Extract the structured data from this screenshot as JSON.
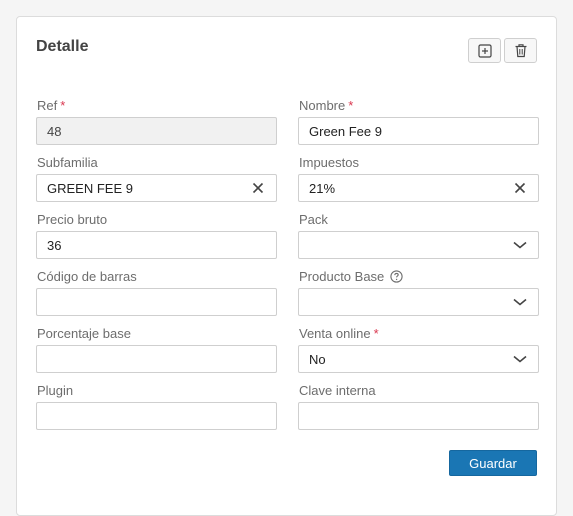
{
  "card": {
    "title": "Detalle"
  },
  "toolbar": {
    "add_icon": "plus-square-icon",
    "delete_icon": "trash-icon"
  },
  "fields": {
    "ref": {
      "label": "Ref",
      "required": "*",
      "value": "48"
    },
    "nombre": {
      "label": "Nombre",
      "required": "*",
      "value": "Green Fee 9"
    },
    "subfamilia": {
      "label": "Subfamilia",
      "value": "GREEN FEE 9",
      "trail_icon": "clear-icon"
    },
    "impuestos": {
      "label": "Impuestos",
      "value": "21%",
      "trail_icon": "clear-icon"
    },
    "precio_bruto": {
      "label": "Precio bruto",
      "value": "36"
    },
    "pack": {
      "label": "Pack",
      "value": "",
      "trail_icon": "chevron-down-icon"
    },
    "codigo_barras": {
      "label": "Código de barras",
      "value": ""
    },
    "producto_base": {
      "label": "Producto Base",
      "help_icon": "help-circle-icon",
      "value": "",
      "trail_icon": "chevron-down-icon"
    },
    "porcentaje_base": {
      "label": "Porcentaje base",
      "value": ""
    },
    "venta_online": {
      "label": "Venta online",
      "required": "*",
      "value": "No",
      "trail_icon": "chevron-down-icon"
    },
    "plugin": {
      "label": "Plugin",
      "value": ""
    },
    "clave_interna": {
      "label": "Clave interna",
      "value": ""
    }
  },
  "actions": {
    "save_label": "Guardar"
  },
  "colors": {
    "primary": "#1a76b4",
    "required": "#d9364e",
    "label": "#6d6d6d",
    "border": "#cfcfcf"
  }
}
